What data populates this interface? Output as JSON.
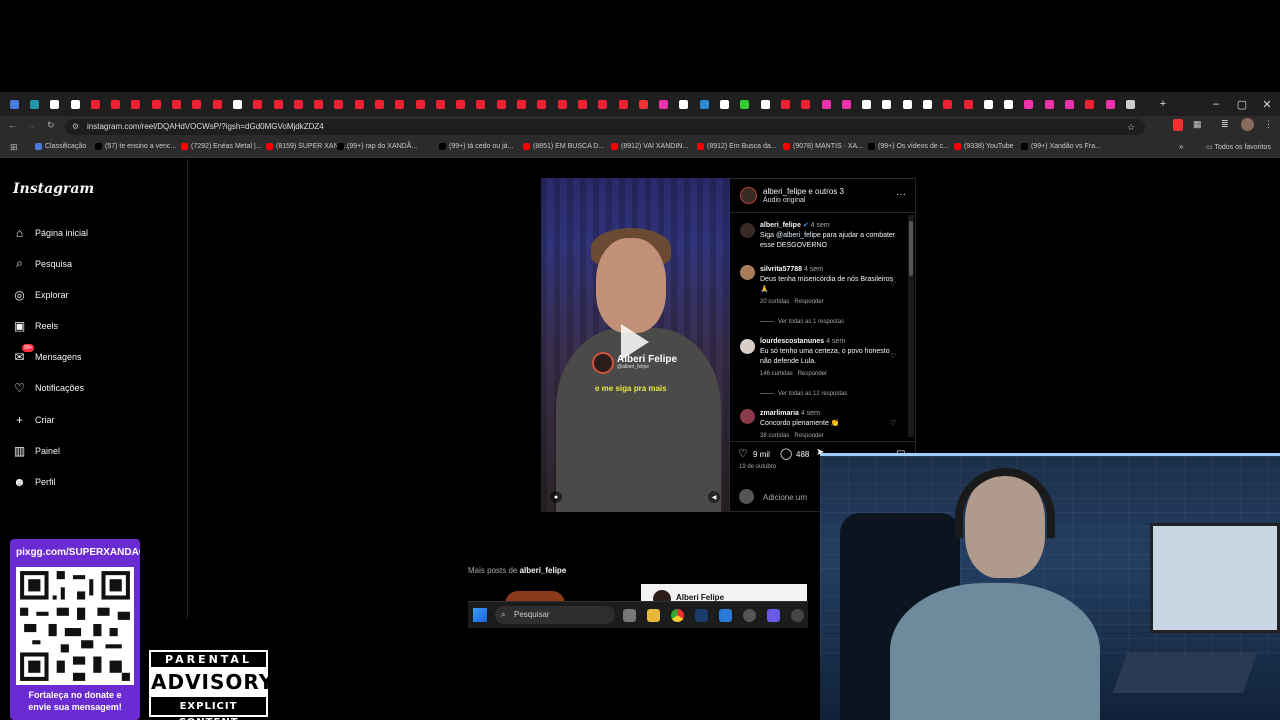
{
  "browser": {
    "tab_count": 56,
    "window_controls": {
      "minimize": "–",
      "maximize": "▢",
      "close": "✕"
    },
    "url": "instagram.com/reel/DQAHdVOCWsP/?igsh=dGd0MGVoMjdkZDZ4",
    "bookmarks": [
      {
        "label": "Classificação",
        "color": "#4a7bd8"
      },
      {
        "label": "(57) te ensino a venc...",
        "color": "#000000"
      },
      {
        "label": "(7292) Enéas Metal |...",
        "color": "#ff0000"
      },
      {
        "label": "(8159) SUPER XAND...",
        "color": "#ff0000"
      },
      {
        "label": "(99+) rap do XANDÃ...",
        "color": "#000000"
      },
      {
        "label": "(99+) tá cedo ou já...",
        "color": "#000000"
      },
      {
        "label": "(8851) EM BUSCA D...",
        "color": "#ff0000"
      },
      {
        "label": "(8912) VAI XANDIN...",
        "color": "#ff0000"
      },
      {
        "label": "(8912) Em Busca da...",
        "color": "#ff0000"
      },
      {
        "label": "(9078) MANTIS · XA...",
        "color": "#ff0000"
      },
      {
        "label": "(99+) Os vídeos de c...",
        "color": "#000000"
      },
      {
        "label": "(9338) YouTube",
        "color": "#ff0000"
      },
      {
        "label": "(99+) Xandão vs Fra...",
        "color": "#000000"
      }
    ],
    "all_bookmarks": "Todos os favoritos"
  },
  "instagram": {
    "logo": "Instagram",
    "nav": [
      {
        "label": "Página inicial",
        "icon": "home-icon"
      },
      {
        "label": "Pesquisa",
        "icon": "search-icon"
      },
      {
        "label": "Explorar",
        "icon": "compass-icon"
      },
      {
        "label": "Reels",
        "icon": "reels-icon"
      },
      {
        "label": "Mensagens",
        "icon": "messenger-icon",
        "badge": "99+"
      },
      {
        "label": "Notificações",
        "icon": "heart-icon"
      },
      {
        "label": "Criar",
        "icon": "plus-icon"
      },
      {
        "label": "Painel",
        "icon": "dashboard-icon"
      },
      {
        "label": "Perfil",
        "icon": "avatar-icon"
      }
    ],
    "reel": {
      "name": "Alberi Felipe",
      "handle": "@alberi_felipe",
      "caption": "e me siga pra mais"
    },
    "post": {
      "header_user": "alberi_felipe e outros 3",
      "header_sub": "Áudio original",
      "caption": {
        "user": "alberi_felipe",
        "time": "4 sem",
        "text_before": "Siga ",
        "mention": "@alberi_felipe",
        "text_after": " para ajudar a combater esse DESGOVERNO"
      },
      "comments": [
        {
          "user": "silvrita57788",
          "time": "4 sem",
          "text": "Deus tenha misericórdia de nós Brasileiros 🙏",
          "likes": "20 curtidas",
          "reply": "Responder",
          "replies": "Ver todas as 1 respostas"
        },
        {
          "user": "lourdescostanunes",
          "time": "4 sem",
          "text": "Eu só tenho uma certeza, o povo honesto não defende Lula.",
          "likes": "146 curtidas",
          "reply": "Responder",
          "replies": "Ver todas as 12 respostas"
        },
        {
          "user": "zmarlimaria",
          "time": "4 sem",
          "text": "Concordo plenamente 👏",
          "likes": "38 curtidas",
          "reply": "Responder",
          "replies": ""
        }
      ],
      "likes_count": "9 mil",
      "comments_count": "488",
      "date": "19 de outubro",
      "add_comment_placeholder": "Adicione um"
    },
    "more_posts_prefix": "Mais posts de ",
    "more_posts_user": "alberi_felipe",
    "thumb_name": "Alberi Felipe"
  },
  "taskbar": {
    "search_placeholder": "Pesquisar"
  },
  "overlay": {
    "qr_url": "pixgg.com/SUPERXANDAO",
    "qr_footer_line1": "Fortaleça no donate e",
    "qr_footer_line2": "envie sua mensagem!",
    "parental_top": "PARENTAL",
    "parental_mid": "ADVISORY",
    "parental_bot": "EXPLICIT CONTENT"
  }
}
